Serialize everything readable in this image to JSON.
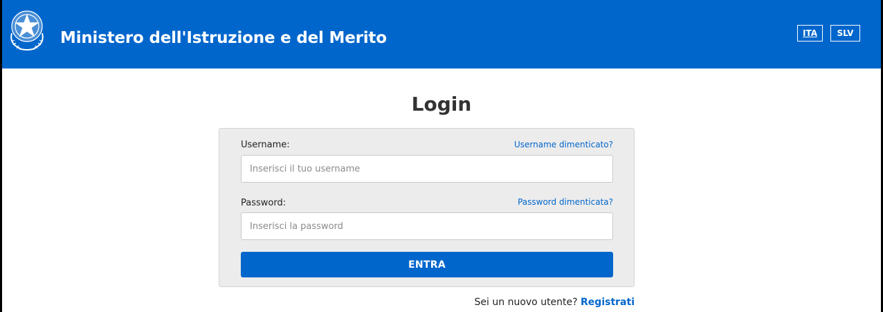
{
  "header": {
    "title": "Ministero dell'Istruzione e del Merito",
    "emblem_icon": "italian-republic-emblem-icon",
    "background_color": "#0066cc",
    "languages": [
      {
        "label": "ITA",
        "selected": true
      },
      {
        "label": "SLV",
        "selected": false
      }
    ]
  },
  "login": {
    "title": "Login",
    "username": {
      "label": "Username:",
      "forgot_link": "Username dimenticato?",
      "placeholder": "Inserisci il tuo username",
      "value": ""
    },
    "password": {
      "label": "Password:",
      "forgot_link": "Password dimenticata?",
      "placeholder": "Inserisci la password",
      "value": ""
    },
    "submit_label": "ENTRA"
  },
  "register": {
    "prompt": "Sei un nuovo utente?",
    "link_label": "Registrati"
  }
}
